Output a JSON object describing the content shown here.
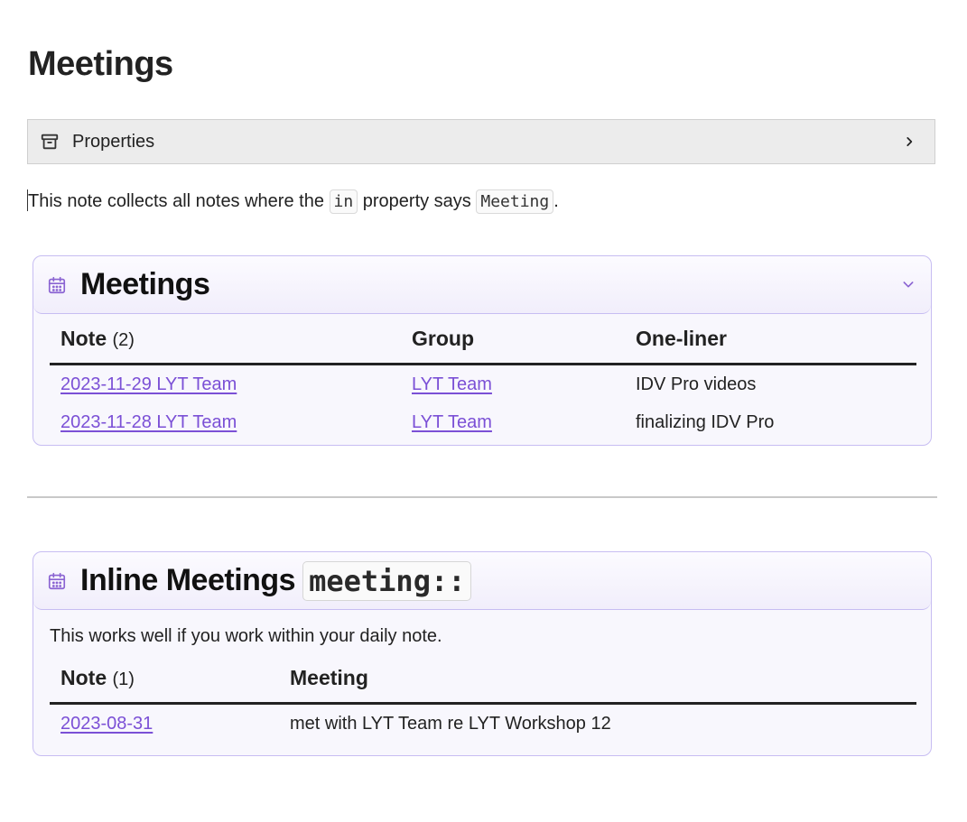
{
  "page": {
    "title": "Meetings"
  },
  "properties": {
    "label": "Properties",
    "icon": "archive-icon",
    "expand_icon": "chevron-right-icon"
  },
  "intro": {
    "text_before": "This note collects all notes where the ",
    "code1": "in",
    "text_middle": " property says ",
    "code2": "Meeting",
    "text_after": "."
  },
  "callout_meetings": {
    "title": "Meetings",
    "icon": "calendar-icon",
    "collapse_icon": "chevron-down-icon",
    "columns": {
      "note": "Note",
      "note_count": "(2)",
      "group": "Group",
      "oneliner": "One-liner"
    },
    "rows": [
      {
        "note": "2023-11-29 LYT Team",
        "group": "LYT Team",
        "oneliner": "IDV Pro videos"
      },
      {
        "note": "2023-11-28 LYT Team",
        "group": "LYT Team",
        "oneliner": "finalizing IDV Pro"
      }
    ]
  },
  "callout_inline": {
    "title": "Inline Meetings",
    "title_code": "meeting::",
    "icon": "calendar-icon",
    "description": "This works well if you work within your daily note.",
    "columns": {
      "note": "Note",
      "note_count": "(1)",
      "meeting": "Meeting"
    },
    "rows": [
      {
        "note": "2023-08-31",
        "meeting": "met with LYT Team re LYT Workshop 12"
      }
    ]
  },
  "colors": {
    "accent": "#7b50d6",
    "callout_border": "#c7bdf2",
    "callout_bg": "#f8f7fd"
  }
}
